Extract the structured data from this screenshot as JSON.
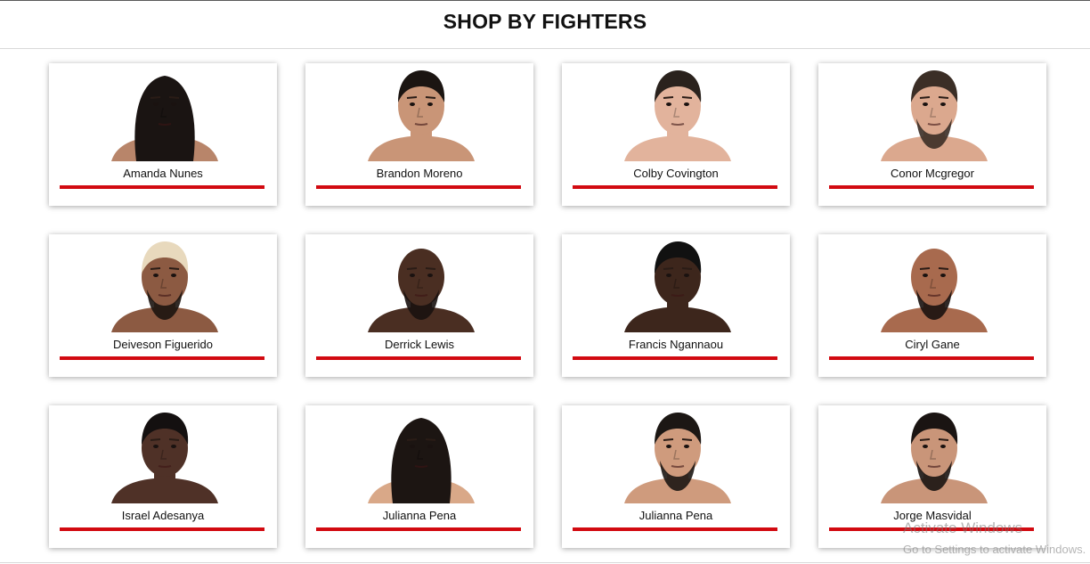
{
  "header": {
    "title": "SHOP BY FIGHTERS"
  },
  "fighters": [
    {
      "name": "Amanda Nunes",
      "skin": "#b8856a",
      "hair": "#1a1412",
      "style": "long"
    },
    {
      "name": "Brandon Moreno",
      "skin": "#c99577",
      "hair": "#1b1512",
      "style": "short"
    },
    {
      "name": "Colby Covington",
      "skin": "#e2b39c",
      "hair": "#2a221d",
      "style": "short"
    },
    {
      "name": "Conor Mcgregor",
      "skin": "#dba88e",
      "hair": "#3b2e26",
      "style": "beard"
    },
    {
      "name": "Deiveson Figuerido",
      "skin": "#8c5a42",
      "hair": "#e8d9bd",
      "style": "bleached"
    },
    {
      "name": "Derrick Lewis",
      "skin": "#4a2e22",
      "hair": "#1a1412",
      "style": "bald"
    },
    {
      "name": "Francis Ngannaou",
      "skin": "#3d261c",
      "hair": "#111111",
      "style": "short"
    },
    {
      "name": "Ciryl Gane",
      "skin": "#a86a4e",
      "hair": "#2a1c16",
      "style": "bald"
    },
    {
      "name": "Israel Adesanya",
      "skin": "#4f3127",
      "hair": "#141010",
      "style": "short"
    },
    {
      "name": "Julianna Pena",
      "skin": "#d9a888",
      "hair": "#1c1512",
      "style": "long"
    },
    {
      "name": "Julianna Pena",
      "skin": "#cf9b7d",
      "hair": "#1c1714",
      "style": "beard"
    },
    {
      "name": "Jorge Masvidal",
      "skin": "#c99579",
      "hair": "#1a1412",
      "style": "beard"
    }
  ],
  "watermark": {
    "title": "Activate Windows",
    "subtitle": "Go to Settings to activate Windows."
  },
  "colors": {
    "accent": "#d20a11",
    "card_bg": "#ffffff",
    "page_bg": "#ffffff"
  }
}
